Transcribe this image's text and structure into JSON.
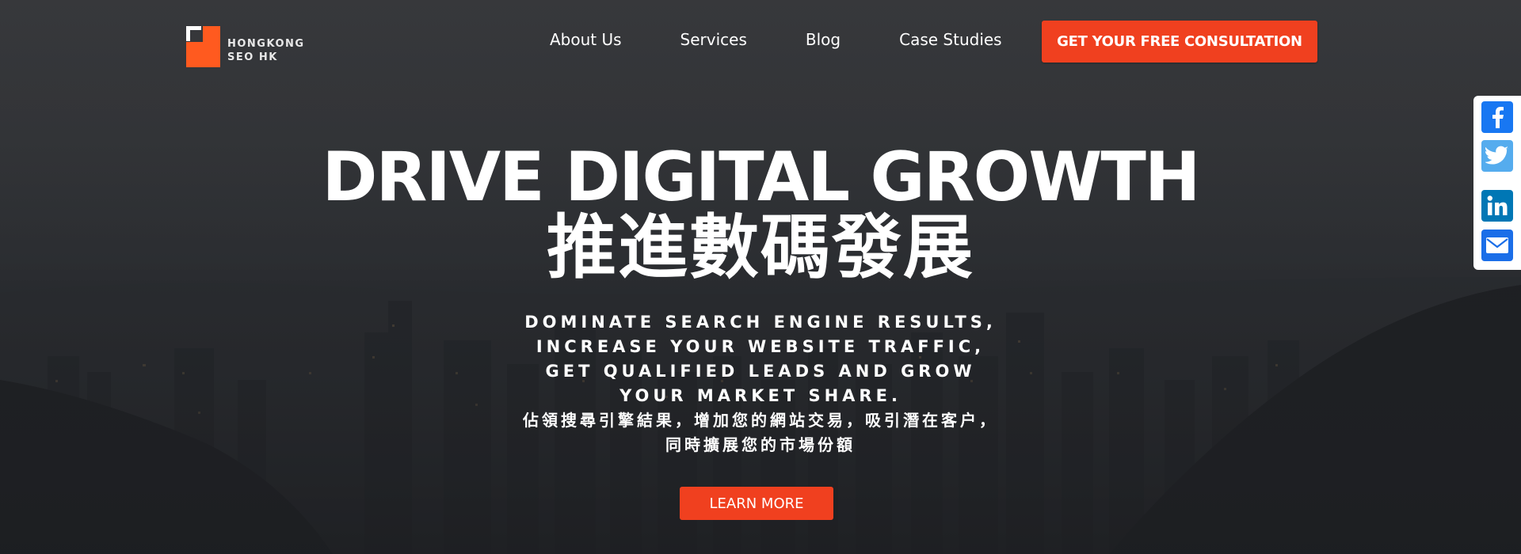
{
  "brand": {
    "line1": "HONGKONG",
    "line2": "SEO HK",
    "accent_color": "#ff5a1f"
  },
  "nav": {
    "items": [
      {
        "label": "About Us"
      },
      {
        "label": "Services"
      },
      {
        "label": "Blog"
      },
      {
        "label": "Case Studies"
      }
    ],
    "cta_label": "GET YOUR FREE CONSULTATION",
    "cta_color": "#f0401f"
  },
  "hero": {
    "headline": "DRIVE DIGITAL GROWTH",
    "headline_zh": "推進數碼發展",
    "sub_en": [
      "DOMINATE SEARCH ENGINE RESULTS,",
      "INCREASE YOUR WEBSITE TRAFFIC,",
      "GET QUALIFIED LEADS AND GROW",
      "YOUR MARKET SHARE."
    ],
    "sub_zh": [
      "佔領搜尋引擎結果，增加您的網站交易，吸引潛在客户，",
      "同時擴展您的市場份額"
    ],
    "button_label": "LEARN MORE"
  },
  "share": {
    "buttons": [
      {
        "icon": "facebook-icon",
        "color": "#1877f2"
      },
      {
        "icon": "twitter-icon",
        "color": "#55acee"
      },
      {
        "icon": "linkedin-icon",
        "color": "#0077b5"
      },
      {
        "icon": "email-icon",
        "color": "#1b6ee8"
      }
    ]
  }
}
